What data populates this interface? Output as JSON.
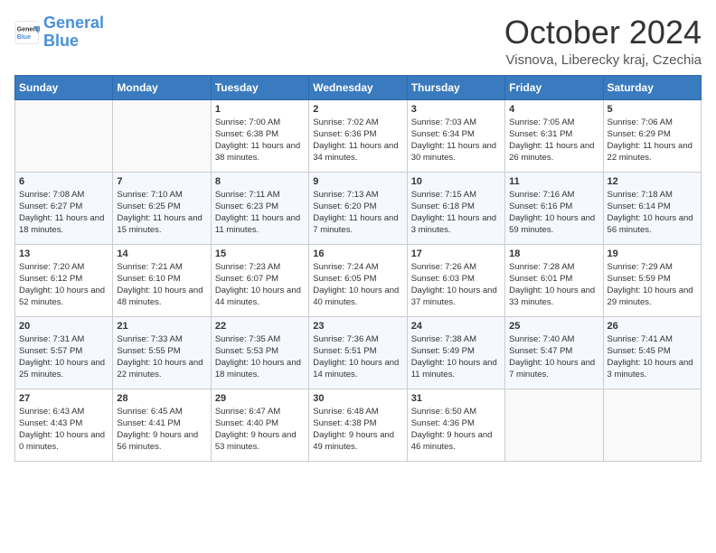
{
  "header": {
    "logo_general": "General",
    "logo_blue": "Blue",
    "month": "October 2024",
    "location": "Visnova, Liberecky kraj, Czechia"
  },
  "days_header": [
    "Sunday",
    "Monday",
    "Tuesday",
    "Wednesday",
    "Thursday",
    "Friday",
    "Saturday"
  ],
  "weeks": [
    [
      {
        "day": "",
        "info": ""
      },
      {
        "day": "",
        "info": ""
      },
      {
        "day": "1",
        "info": "Sunrise: 7:00 AM\nSunset: 6:38 PM\nDaylight: 11 hours and 38 minutes."
      },
      {
        "day": "2",
        "info": "Sunrise: 7:02 AM\nSunset: 6:36 PM\nDaylight: 11 hours and 34 minutes."
      },
      {
        "day": "3",
        "info": "Sunrise: 7:03 AM\nSunset: 6:34 PM\nDaylight: 11 hours and 30 minutes."
      },
      {
        "day": "4",
        "info": "Sunrise: 7:05 AM\nSunset: 6:31 PM\nDaylight: 11 hours and 26 minutes."
      },
      {
        "day": "5",
        "info": "Sunrise: 7:06 AM\nSunset: 6:29 PM\nDaylight: 11 hours and 22 minutes."
      }
    ],
    [
      {
        "day": "6",
        "info": "Sunrise: 7:08 AM\nSunset: 6:27 PM\nDaylight: 11 hours and 18 minutes."
      },
      {
        "day": "7",
        "info": "Sunrise: 7:10 AM\nSunset: 6:25 PM\nDaylight: 11 hours and 15 minutes."
      },
      {
        "day": "8",
        "info": "Sunrise: 7:11 AM\nSunset: 6:23 PM\nDaylight: 11 hours and 11 minutes."
      },
      {
        "day": "9",
        "info": "Sunrise: 7:13 AM\nSunset: 6:20 PM\nDaylight: 11 hours and 7 minutes."
      },
      {
        "day": "10",
        "info": "Sunrise: 7:15 AM\nSunset: 6:18 PM\nDaylight: 11 hours and 3 minutes."
      },
      {
        "day": "11",
        "info": "Sunrise: 7:16 AM\nSunset: 6:16 PM\nDaylight: 10 hours and 59 minutes."
      },
      {
        "day": "12",
        "info": "Sunrise: 7:18 AM\nSunset: 6:14 PM\nDaylight: 10 hours and 56 minutes."
      }
    ],
    [
      {
        "day": "13",
        "info": "Sunrise: 7:20 AM\nSunset: 6:12 PM\nDaylight: 10 hours and 52 minutes."
      },
      {
        "day": "14",
        "info": "Sunrise: 7:21 AM\nSunset: 6:10 PM\nDaylight: 10 hours and 48 minutes."
      },
      {
        "day": "15",
        "info": "Sunrise: 7:23 AM\nSunset: 6:07 PM\nDaylight: 10 hours and 44 minutes."
      },
      {
        "day": "16",
        "info": "Sunrise: 7:24 AM\nSunset: 6:05 PM\nDaylight: 10 hours and 40 minutes."
      },
      {
        "day": "17",
        "info": "Sunrise: 7:26 AM\nSunset: 6:03 PM\nDaylight: 10 hours and 37 minutes."
      },
      {
        "day": "18",
        "info": "Sunrise: 7:28 AM\nSunset: 6:01 PM\nDaylight: 10 hours and 33 minutes."
      },
      {
        "day": "19",
        "info": "Sunrise: 7:29 AM\nSunset: 5:59 PM\nDaylight: 10 hours and 29 minutes."
      }
    ],
    [
      {
        "day": "20",
        "info": "Sunrise: 7:31 AM\nSunset: 5:57 PM\nDaylight: 10 hours and 25 minutes."
      },
      {
        "day": "21",
        "info": "Sunrise: 7:33 AM\nSunset: 5:55 PM\nDaylight: 10 hours and 22 minutes."
      },
      {
        "day": "22",
        "info": "Sunrise: 7:35 AM\nSunset: 5:53 PM\nDaylight: 10 hours and 18 minutes."
      },
      {
        "day": "23",
        "info": "Sunrise: 7:36 AM\nSunset: 5:51 PM\nDaylight: 10 hours and 14 minutes."
      },
      {
        "day": "24",
        "info": "Sunrise: 7:38 AM\nSunset: 5:49 PM\nDaylight: 10 hours and 11 minutes."
      },
      {
        "day": "25",
        "info": "Sunrise: 7:40 AM\nSunset: 5:47 PM\nDaylight: 10 hours and 7 minutes."
      },
      {
        "day": "26",
        "info": "Sunrise: 7:41 AM\nSunset: 5:45 PM\nDaylight: 10 hours and 3 minutes."
      }
    ],
    [
      {
        "day": "27",
        "info": "Sunrise: 6:43 AM\nSunset: 4:43 PM\nDaylight: 10 hours and 0 minutes."
      },
      {
        "day": "28",
        "info": "Sunrise: 6:45 AM\nSunset: 4:41 PM\nDaylight: 9 hours and 56 minutes."
      },
      {
        "day": "29",
        "info": "Sunrise: 6:47 AM\nSunset: 4:40 PM\nDaylight: 9 hours and 53 minutes."
      },
      {
        "day": "30",
        "info": "Sunrise: 6:48 AM\nSunset: 4:38 PM\nDaylight: 9 hours and 49 minutes."
      },
      {
        "day": "31",
        "info": "Sunrise: 6:50 AM\nSunset: 4:36 PM\nDaylight: 9 hours and 46 minutes."
      },
      {
        "day": "",
        "info": ""
      },
      {
        "day": "",
        "info": ""
      }
    ]
  ]
}
